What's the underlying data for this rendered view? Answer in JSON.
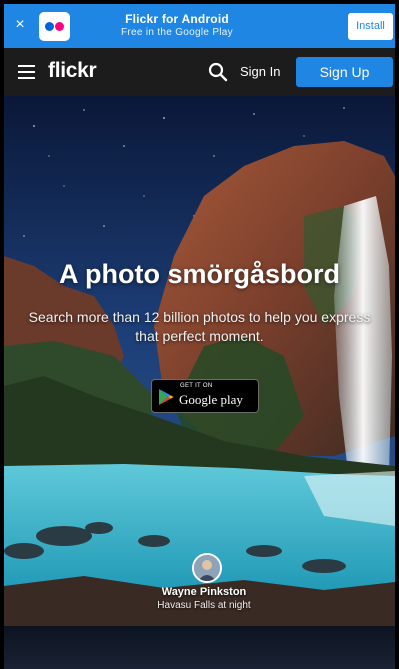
{
  "app_banner": {
    "close_glyph": "×",
    "app_name": "Flickr for Android",
    "subtitle": "Free in the Google Play",
    "install_label": "Install"
  },
  "header": {
    "logo": "flickr",
    "signin_label": "Sign In",
    "signup_label": "Sign Up",
    "icons": [
      "menu-icon",
      "search-icon"
    ]
  },
  "hero": {
    "title": "A photo smörgåsbord",
    "subtitle": "Search more than 12 billion photos to help you express that perfect moment.",
    "badge": {
      "small_text": "GET IT ON",
      "store_name": "Google play"
    },
    "credit": {
      "name": "Wayne Pinkston",
      "place": "Havasu Falls at night"
    }
  },
  "colors": {
    "brand_blue": "#1f86e3",
    "header_bg": "#1c1c1c",
    "flickr_blue": "#0063dc",
    "flickr_pink": "#ff0084"
  }
}
